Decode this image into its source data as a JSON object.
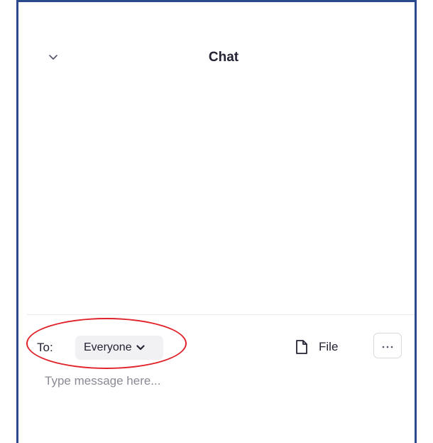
{
  "header": {
    "title": "Chat",
    "collapse_icon": "chevron-down-icon"
  },
  "composer": {
    "to_label": "To:",
    "recipient": "Everyone",
    "recipient_icon": "chevron-down-icon",
    "file_label": "File",
    "file_icon": "file-icon",
    "more_icon": "more-icon",
    "input_value": "",
    "input_placeholder": "Type message here..."
  },
  "colors": {
    "frame_border": "#2b4a8b",
    "highlight": "#e0232a",
    "text": "#232333",
    "placeholder": "#8a8a94",
    "recipient_bg": "#f1f1f4"
  }
}
